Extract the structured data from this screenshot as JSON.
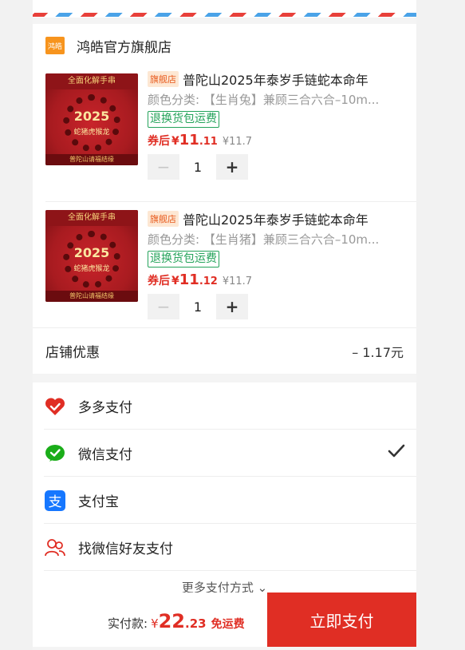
{
  "shop": {
    "logo_text": "鸿皓",
    "name": "鸿皓官方旗舰店"
  },
  "items": [
    {
      "flag": "旗舰店",
      "title": "普陀山2025年泰岁手链蛇本命年",
      "spec": "颜色分类: 【生肖兔】兼顾三合六合–10m...",
      "tag": "退换货包运费",
      "price_label": "券后",
      "currency": "¥",
      "price_int": "11",
      "price_dec": ".11",
      "orig_price": "¥11.7",
      "minus": "−",
      "qty": "1",
      "plus": "+",
      "thumb": {
        "band": "全面化解手串",
        "year": "2025",
        "sub": "蛇猪虎猴龙",
        "foot": "普陀山请福结缘"
      }
    },
    {
      "flag": "旗舰店",
      "title": "普陀山2025年泰岁手链蛇本命年",
      "spec": "颜色分类: 【生肖猪】兼顾三合六合–10m...",
      "tag": "退换货包运费",
      "price_label": "券后",
      "currency": "¥",
      "price_int": "11",
      "price_dec": ".12",
      "orig_price": "¥11.7",
      "minus": "−",
      "qty": "1",
      "plus": "+",
      "thumb": {
        "band": "全面化解手串",
        "year": "2025",
        "sub": "蛇猪虎猴龙",
        "foot": "普陀山请福结缘"
      }
    }
  ],
  "discount": {
    "label": "店铺优惠",
    "value": "– 1.17元"
  },
  "payment": {
    "methods": [
      {
        "label": "多多支付",
        "icon": "heart-icon",
        "color": "#e02e24"
      },
      {
        "label": "微信支付",
        "icon": "wechat-icon",
        "color": "#1aad19",
        "selected": true
      },
      {
        "label": "支付宝",
        "icon": "alipay-icon",
        "color": "#1677ff"
      },
      {
        "label": "找微信好友支付",
        "icon": "friends-icon",
        "color": "#e02e24"
      }
    ],
    "more": "更多支付方式 ⌄"
  },
  "footer": {
    "total_label": "实付款:",
    "currency": "¥",
    "total_int": "22",
    "total_dec": ".23",
    "shipping": "免运费",
    "pay_button": "立即支付"
  },
  "colors": {
    "accent": "#e02e24",
    "wechat": "#1aad19",
    "alipay": "#1677ff",
    "tag_green": "#24a35a"
  }
}
